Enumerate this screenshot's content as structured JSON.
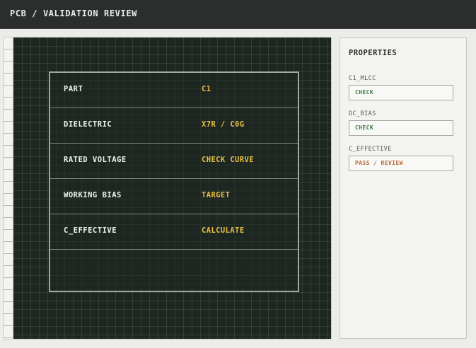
{
  "header": {
    "title": "PCB / VALIDATION REVIEW"
  },
  "table": {
    "rows": [
      {
        "label": "PART",
        "value": "C1"
      },
      {
        "label": "DIELECTRIC",
        "value": "X7R / C0G"
      },
      {
        "label": "RATED VOLTAGE",
        "value": "CHECK CURVE"
      },
      {
        "label": "WORKING BIAS",
        "value": "TARGET"
      },
      {
        "label": "C_EFFECTIVE",
        "value": "CALCULATE"
      }
    ]
  },
  "properties": {
    "title": "PROPERTIES",
    "items": [
      {
        "label": "C1_MLCC",
        "value": "CHECK",
        "status_color": "#3f7a45"
      },
      {
        "label": "DC_BIAS",
        "value": "CHECK",
        "status_color": "#3f7a45"
      },
      {
        "label": "C_EFFECTIVE",
        "value": "PASS / REVIEW",
        "status_color": "#b86a3a"
      }
    ]
  },
  "colors": {
    "canvas_bg": "#1e2621",
    "value_accent": "#e6bf45",
    "header_bg": "#2b2e2c"
  }
}
